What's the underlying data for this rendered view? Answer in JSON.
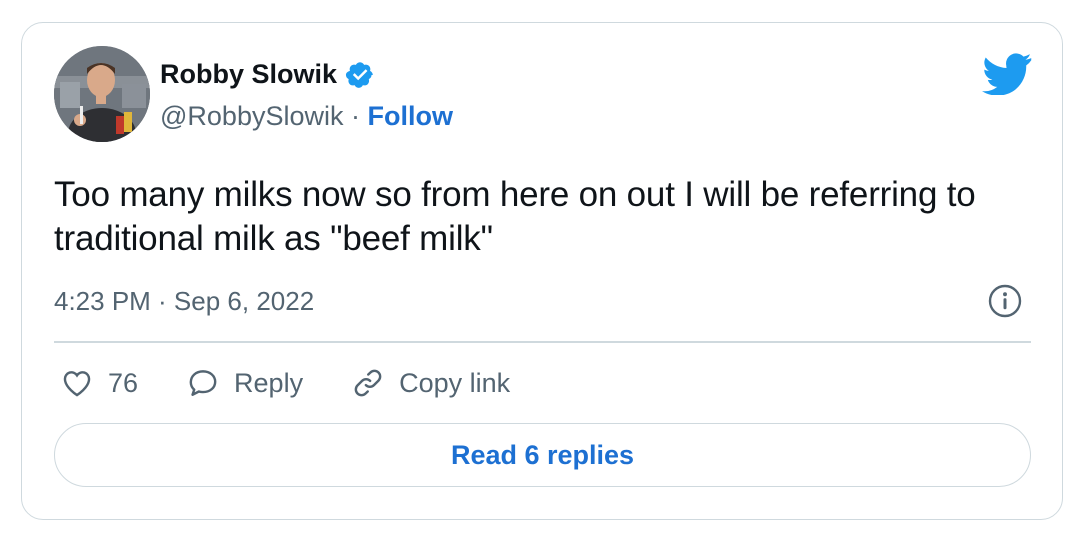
{
  "tweet": {
    "author_name": "Robby Slowik",
    "handle": "@RobbySlowik",
    "separator": " · ",
    "follow_label": "Follow",
    "text": "Too many milks now so from here on out I will be referring to traditional milk as \"beef milk\"",
    "time": "4:23 PM · Sep 6, 2022"
  },
  "actions": {
    "like_count": "76",
    "reply_label": "Reply",
    "copy_link_label": "Copy link"
  },
  "read_replies_label": "Read 6 replies",
  "colors": {
    "accent": "#1d70d2",
    "twitter_blue": "#1d9bf0",
    "secondary_text": "#536471",
    "border": "#cfd9de"
  },
  "icons": [
    "verified-badge-icon",
    "twitter-bird-icon",
    "info-icon",
    "heart-icon",
    "reply-bubble-icon",
    "link-icon"
  ]
}
